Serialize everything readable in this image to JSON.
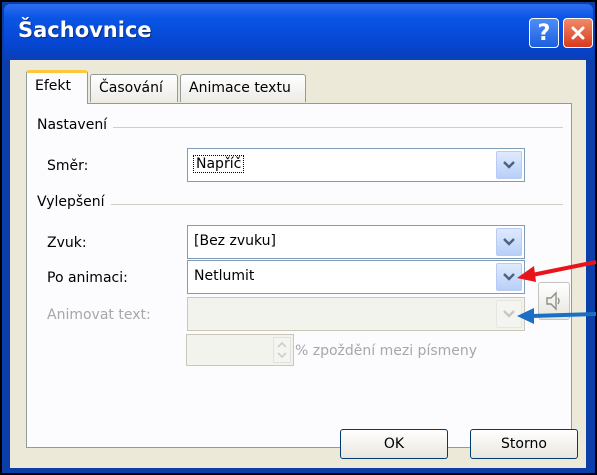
{
  "window": {
    "title": "Šachovnice",
    "help_button": "?",
    "close_button": "✕"
  },
  "tabs": [
    {
      "label": "Efekt",
      "active": true
    },
    {
      "label": "Časování",
      "active": false
    },
    {
      "label": "Animace textu",
      "active": false
    }
  ],
  "settings_group": {
    "label": "Nastavení",
    "direction_label": "Směr:",
    "direction_value": "Napříč"
  },
  "enhancements_group": {
    "label": "Vylepšení",
    "sound_label": "Zvuk:",
    "sound_value": "[Bez zvuku]",
    "after_label": "Po animaci:",
    "after_value": "Netlumit",
    "animate_text_label": "Animovat text:",
    "animate_text_value": "",
    "delay_suffix": "% zpoždění mezi písmeny"
  },
  "buttons": {
    "ok": "OK",
    "cancel": "Storno"
  },
  "colors": {
    "red_arrow": "#e8141a",
    "blue_arrow": "#1a6fc4",
    "titlebar": "#0546d2"
  }
}
